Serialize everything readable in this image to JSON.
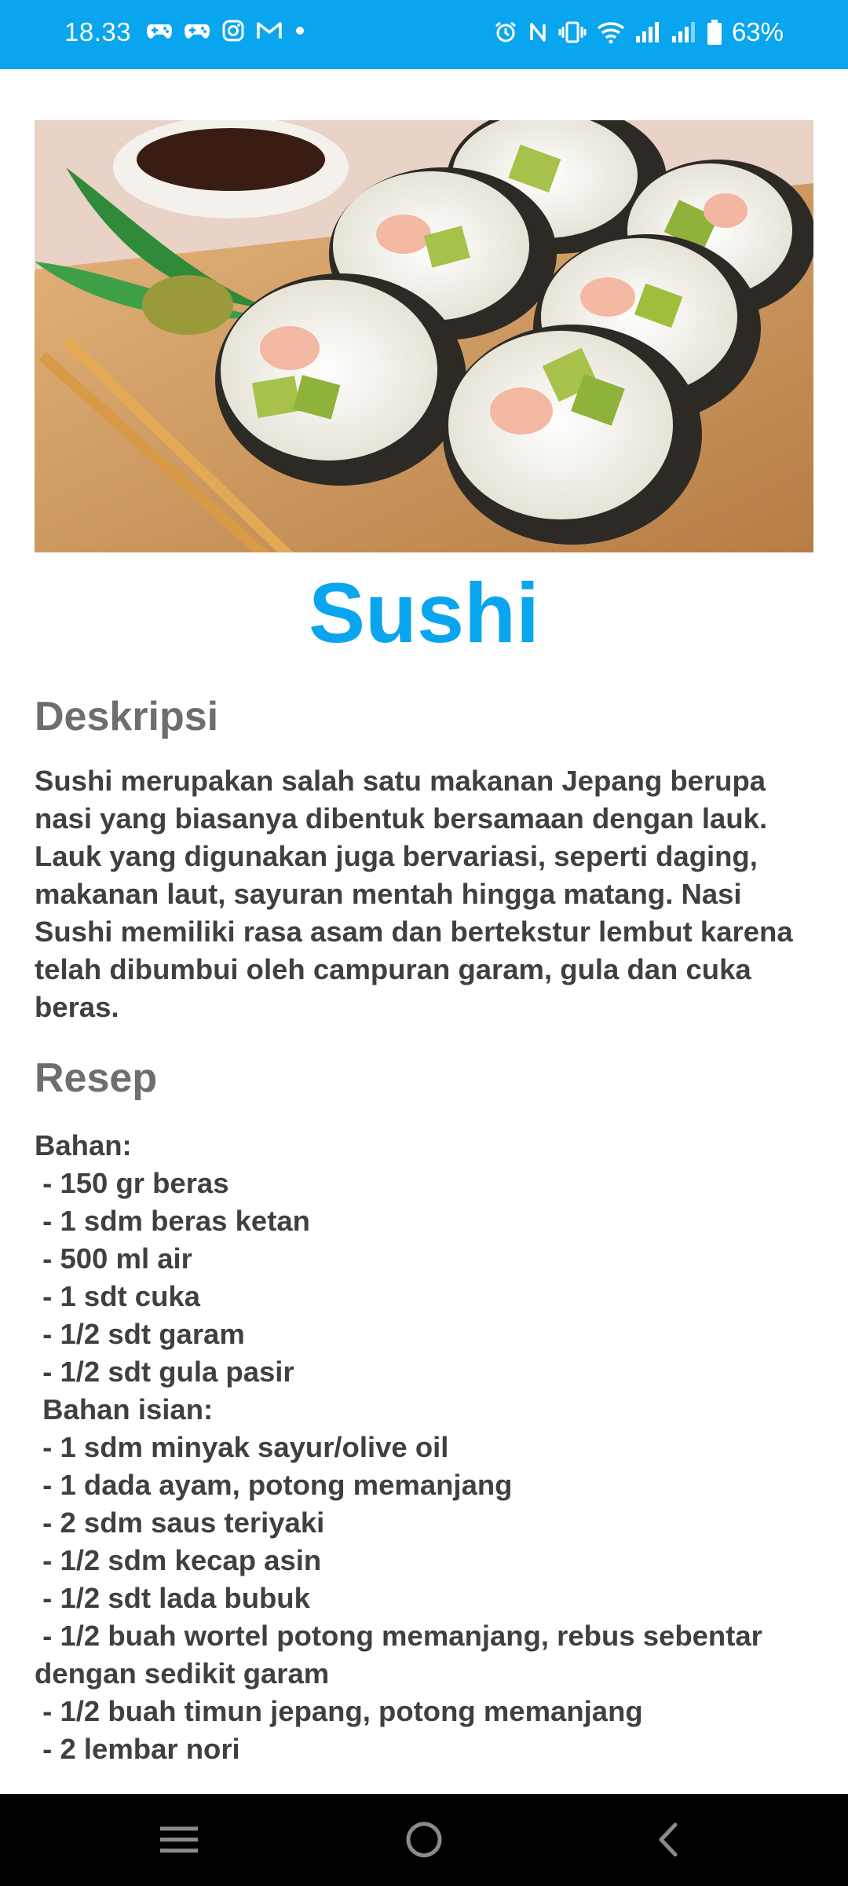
{
  "status_bar": {
    "time": "18.33",
    "battery_percent": "63%",
    "background_color": "#0aa5ef",
    "left_icons": [
      "gamepad-icon",
      "gamepad-icon",
      "instagram-icon",
      "gmail-icon",
      "dot-icon"
    ],
    "right_icons": [
      "alarm-icon",
      "nfc-icon",
      "vibrate-icon",
      "wifi-icon",
      "signal-icon",
      "signal-icon",
      "battery-icon"
    ]
  },
  "hero_image": {
    "alt": "sushi-photo"
  },
  "title": "Sushi",
  "accent_color": "#0aa5ef",
  "description": {
    "heading": "Deskripsi",
    "text": "Sushi merupakan salah satu makanan Jepang berupa nasi yang biasanya dibentuk bersamaan dengan lauk. Lauk yang digunakan juga bervariasi, seperti daging, makanan laut, sayuran mentah hingga matang. Nasi Sushi memiliki rasa asam dan bertekstur lembut karena telah dibumbui oleh campuran garam, gula dan cuka beras."
  },
  "recipe": {
    "heading": "Resep",
    "lines": [
      "Bahan:",
      " - 150 gr beras",
      " - 1 sdm beras ketan",
      " - 500 ml air",
      " - 1 sdt cuka",
      " - 1/2 sdt garam",
      " - 1/2 sdt gula pasir",
      " Bahan isian:",
      " - 1 sdm minyak sayur/olive oil",
      " - 1 dada ayam, potong memanjang",
      " - 2 sdm saus teriyaki",
      " - 1/2 sdm kecap asin",
      " - 1/2 sdt lada bubuk",
      " - 1/2 buah wortel potong memanjang, rebus sebentar dengan sedikit garam",
      " - 1/2 buah timun jepang, potong memanjang",
      " - 2 lembar nori"
    ]
  },
  "nav_bar": {
    "buttons": [
      "menu-icon",
      "home-icon",
      "back-icon"
    ]
  }
}
